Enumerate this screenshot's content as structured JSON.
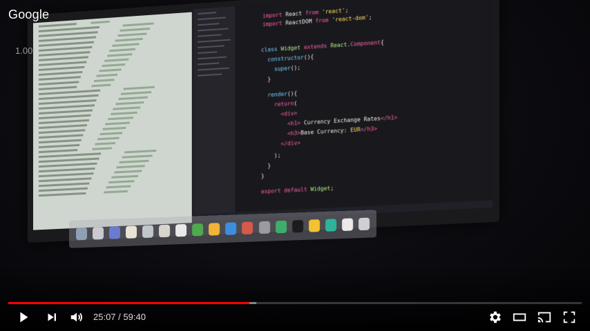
{
  "overlay": {
    "brand": "Google",
    "playback_speed": "1.00"
  },
  "screen": {
    "code_lines": [
      "import React from 'react';",
      "import ReactDOM from 'react-dom';",
      "class Widget extends React.Component{",
      "  constructor(){",
      "    super();",
      "  }",
      "  render(){",
      "    return(",
      "      <div>",
      "        <h1> Currency Exchange Rates</h1>",
      "        <h3>Base Currency: EUR</h3>",
      "      </div>",
      "    );",
      "  }",
      "}",
      "export default Widget;"
    ]
  },
  "player": {
    "current_time": "25:07",
    "separator": " / ",
    "duration": "59:40",
    "progress_fraction": 0.421,
    "buffered_fraction": 0.433,
    "colors": {
      "played": "#ff0000",
      "buffered": "#aaaaaa",
      "track": "#555555"
    },
    "icons": [
      "play-icon",
      "next-icon",
      "volume-icon",
      "settings-icon",
      "theater-mode-icon",
      "cast-icon",
      "fullscreen-icon"
    ]
  }
}
